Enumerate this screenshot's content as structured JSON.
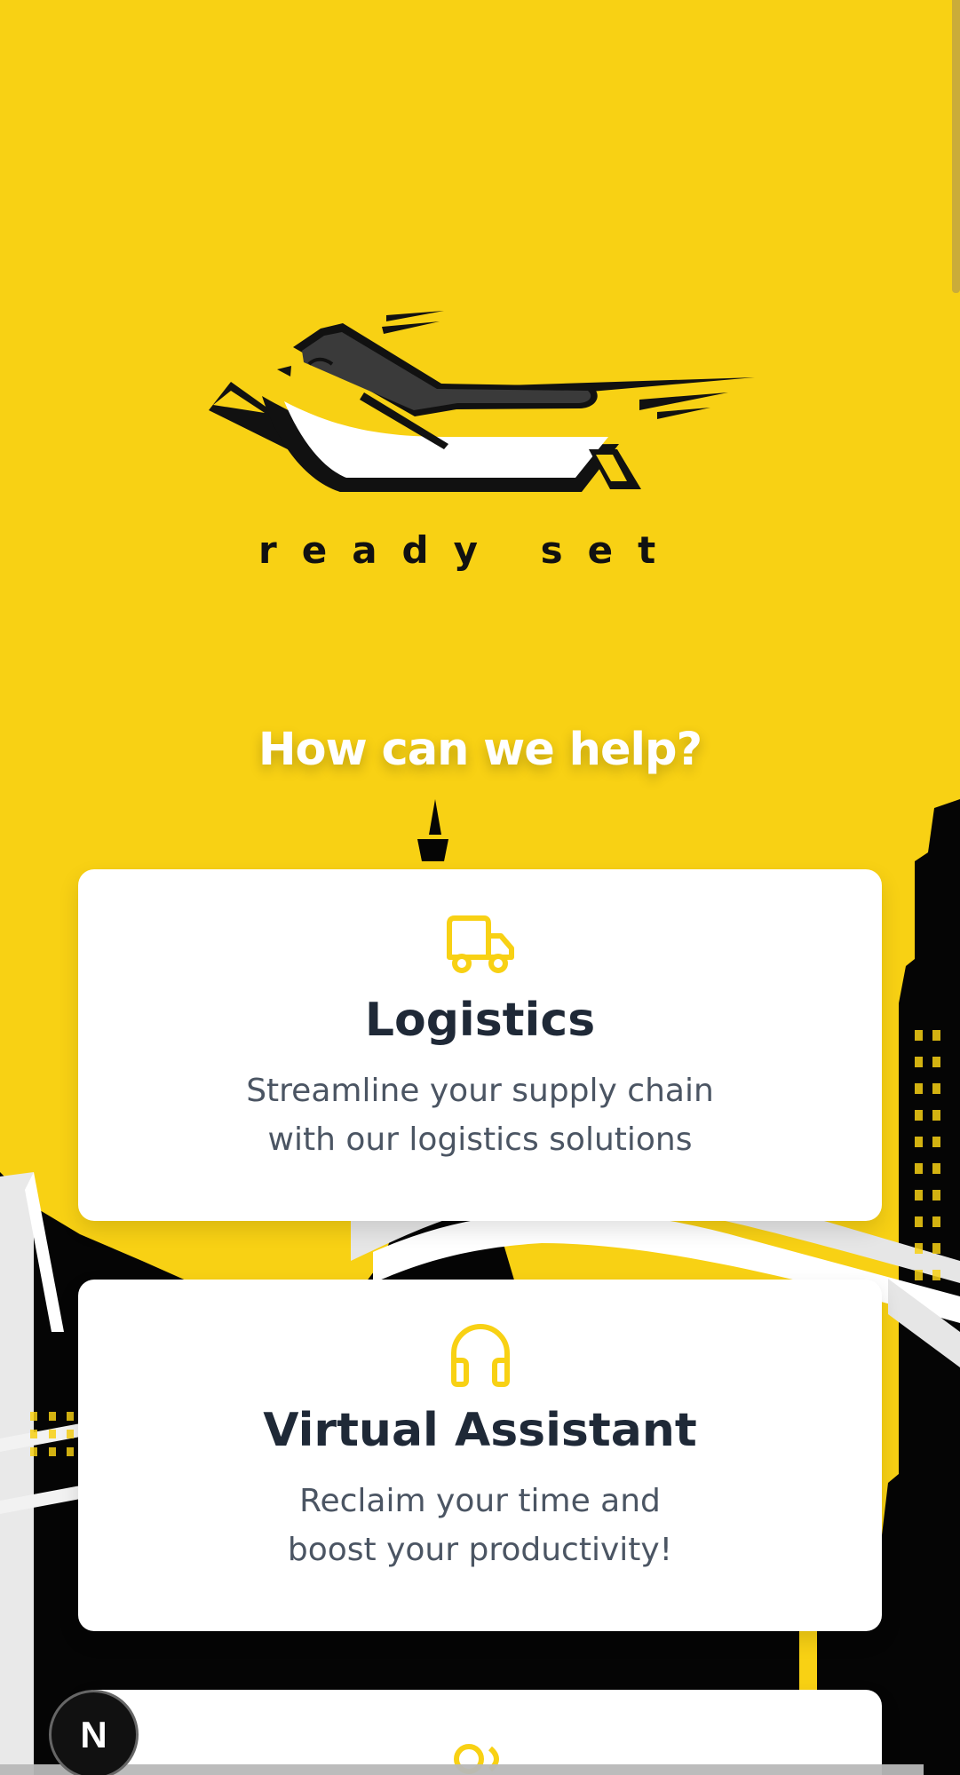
{
  "brand": {
    "wordmark": "ready set"
  },
  "hero": {
    "headline": "How can we help?"
  },
  "services": [
    {
      "icon": "truck-icon",
      "title": "Logistics",
      "description_line_1": "Streamline your supply chain",
      "description_line_2": "with our logistics solutions"
    },
    {
      "icon": "headphones-icon",
      "title": "Virtual Assistant",
      "description_line_1": "Reclaim your time and",
      "description_line_2": "boost your productivity!"
    },
    {
      "icon": "partial-icon",
      "title": "",
      "description_line_1": "",
      "description_line_2": ""
    }
  ],
  "floating_badge": {
    "label": "N"
  },
  "colors": {
    "background": "#f8d114",
    "card": "#ffffff",
    "title": "#1f2937",
    "text": "#4b5563",
    "accent": "#f8d114",
    "dark": "#111111"
  }
}
